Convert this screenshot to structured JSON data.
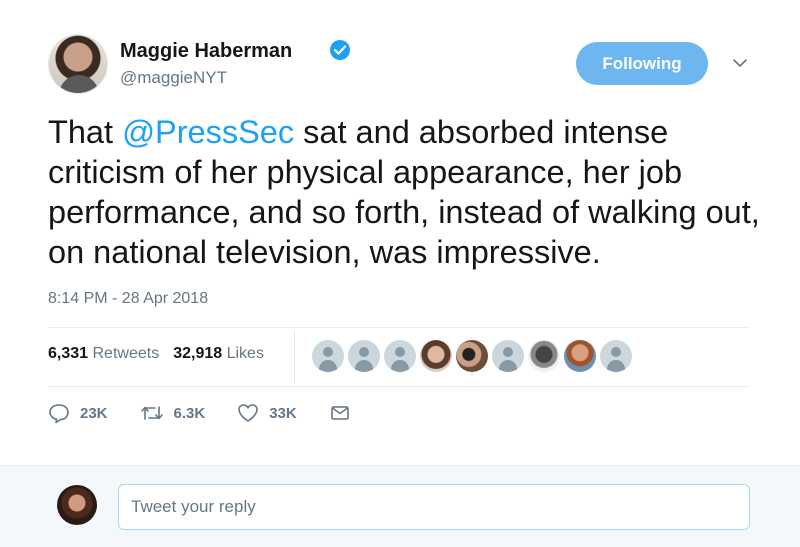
{
  "author": {
    "name": "Maggie Haberman",
    "handle": "@maggieNYT",
    "verified": true
  },
  "follow_button": {
    "label": "Following"
  },
  "tweet": {
    "text_before": "That ",
    "mention": "@PressSec",
    "text_after": " sat and absorbed intense criticism of her physical appearance, her job performance, and so forth, instead of walking out, on national television, was impressive.",
    "timestamp": "8:14 PM - 28 Apr 2018"
  },
  "stats": {
    "retweets_count": "6,331",
    "retweets_label": "Retweets",
    "likes_count": "32,918",
    "likes_label": "Likes"
  },
  "likers": [
    "default",
    "default",
    "default",
    "photo1",
    "photo2",
    "default",
    "photo3",
    "photo4",
    "default"
  ],
  "actions": {
    "reply_count": "23K",
    "retweet_count": "6.3K",
    "like_count": "33K"
  },
  "reply": {
    "placeholder": "Tweet your reply"
  },
  "colors": {
    "accent": "#1da1f2",
    "following_button": "#6db6ef",
    "secondary_text": "#657786"
  },
  "icons": [
    "verified-badge-icon",
    "chevron-down-icon",
    "reply-icon",
    "retweet-icon",
    "like-icon",
    "dm-icon"
  ]
}
